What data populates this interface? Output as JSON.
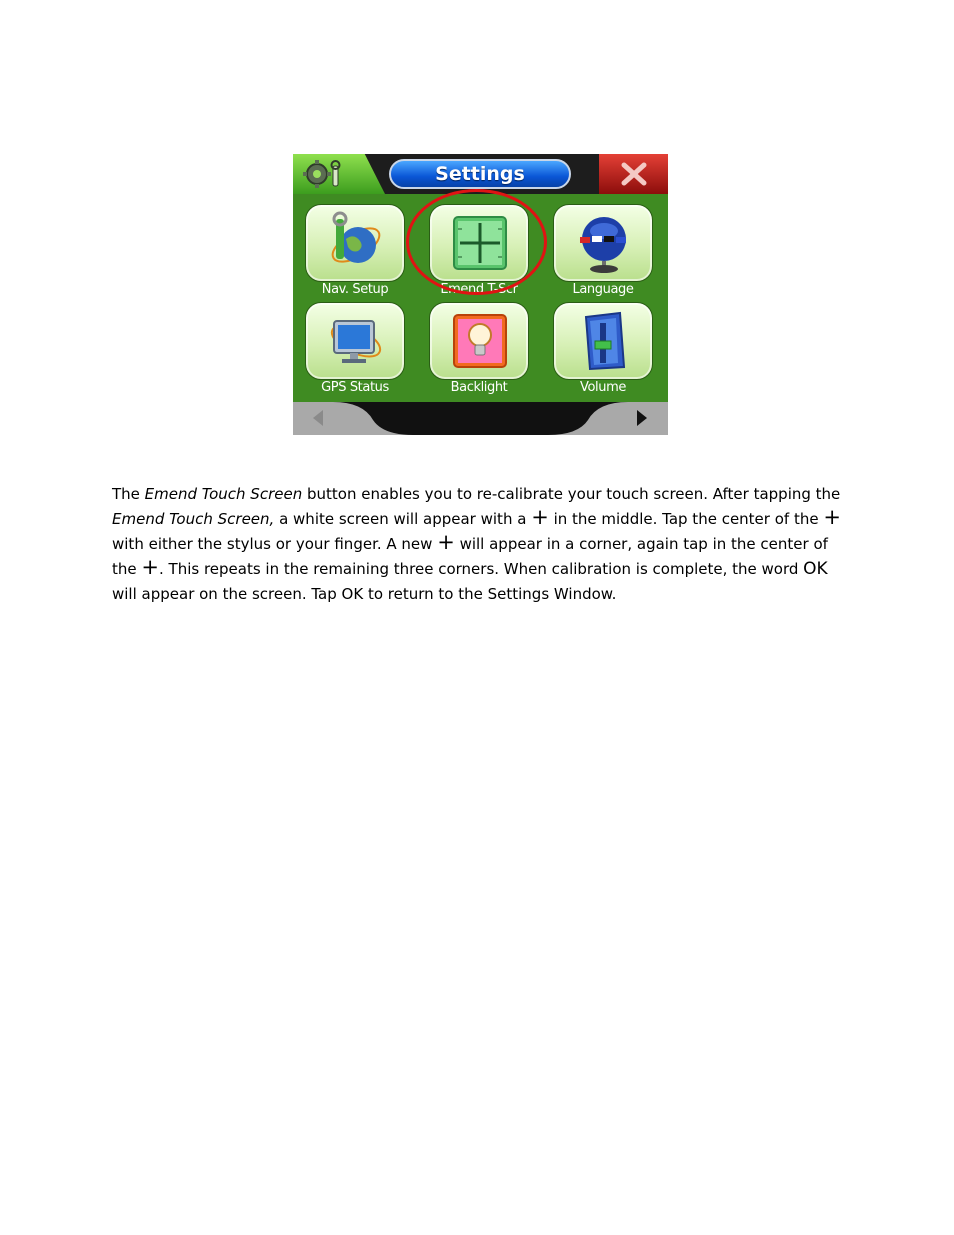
{
  "window": {
    "title": "Settings",
    "settings_icon": "gear-wrench-icon",
    "close_icon": "close-x-icon"
  },
  "tiles": [
    {
      "label": "Nav. Setup",
      "icon": "globe-wrench-icon"
    },
    {
      "label": "Emend T-Scr",
      "icon": "crosshair-calibration-icon",
      "highlighted": true
    },
    {
      "label": "Language",
      "icon": "globe-flags-icon"
    },
    {
      "label": "GPS Status",
      "icon": "monitor-satellite-icon"
    },
    {
      "label": "Backlight",
      "icon": "lightbulb-icon"
    },
    {
      "label": "Volume",
      "icon": "volume-slider-icon"
    }
  ],
  "nav": {
    "prev_icon": "arrow-left-icon",
    "next_icon": "arrow-right-icon"
  },
  "colors": {
    "panel_green": "#3f8b22",
    "highlight_ring": "#e01313",
    "title_blue": "#0a56d6",
    "close_red": "#c0241c"
  },
  "description": {
    "t1": "The ",
    "t2": "Emend Touch Screen",
    "t3": " button enables you to re-calibrate your touch screen.  After tapping the ",
    "t4": "Emend Touch Screen,",
    "t5": " a white screen will appear with a ",
    "plus": "+",
    "t6": " in the middle.  Tap the center of the ",
    "t7": " with either the stylus or your finger.  A new ",
    "t8": " will appear in a corner, again tap in the center of the ",
    "t9": ".  This repeats in the remaining three corners.  When calibration is complete, the word ",
    "ok": "OK",
    "t10": " will appear on the screen.  Tap OK to return to the Settings Window."
  }
}
